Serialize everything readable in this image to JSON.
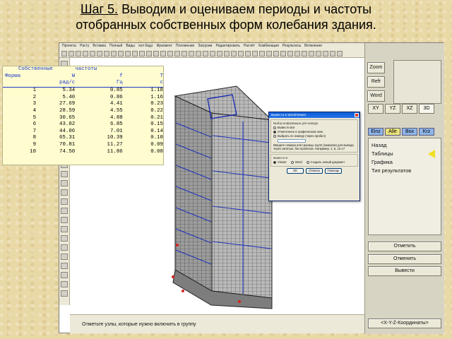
{
  "slide": {
    "step": "Шаг 5.",
    "title_rest": " Выводим и оцениваем периоды и частоты",
    "title_line2": "отобранных собственных форм колебания здания."
  },
  "menu": [
    "Проекты",
    "Расту",
    "Вставка",
    "Полный",
    "Виды",
    "хол бадэ",
    "Фрагмент",
    "Положение",
    "Загрузки",
    "Редактировать",
    "Расчёт",
    "Комбинации",
    "Результаты",
    "Ветвление"
  ],
  "freq_table": {
    "title_left": "Собственные",
    "title_right": "частоты",
    "head1": [
      "Форма",
      "W",
      "f",
      "T"
    ],
    "head2": [
      "",
      "рад/с",
      "Гц",
      "с"
    ],
    "rows": [
      [
        "1",
        "5.34",
        "0.85",
        "1.18"
      ],
      [
        "2",
        "5.40",
        "0.86",
        "1.16"
      ],
      [
        "3",
        "27.69",
        "4.41",
        "0.23"
      ],
      [
        "4",
        "28.59",
        "4.55",
        "0.22"
      ],
      [
        "5",
        "30.65",
        "4.88",
        "0.21"
      ],
      [
        "6",
        "43.02",
        "6.85",
        "0.15"
      ],
      [
        "7",
        "44.06",
        "7.01",
        "0.14"
      ],
      [
        "8",
        "65.31",
        "10.39",
        "0.10"
      ],
      [
        "9",
        "70.81",
        "11.27",
        "0.09"
      ],
      [
        "10",
        "74.50",
        "11.86",
        "0.08"
      ]
    ]
  },
  "dialog": {
    "title": "Вывести в Word/Viewer",
    "group1_legend": "Выбор информации для вывода",
    "opt1": "Вывести всё",
    "opt2": "Отмеченное в графическом окне",
    "opt3": "Выбрать по номеру (через пробел)",
    "hint": "Введите номера или границы групп (номеров) для вывода через запятую, без пробелов. Например, 1, 5, 12-17",
    "group2_legend": "Вывести в",
    "out1": "Viewer",
    "out2": "Word",
    "out3": "Создать новый документ",
    "ok": "OK",
    "cancel": "Отмена",
    "help": "Помощь"
  },
  "right_panel": {
    "zoom": "Zoom",
    "refr": "Refr",
    "word": "Word",
    "views": [
      "XY",
      "YZ",
      "XZ",
      "3D"
    ],
    "modes": [
      {
        "label": "Einz",
        "color": "#8fb4e8"
      },
      {
        "label": "Alle",
        "color": "#e9e07a"
      },
      {
        "label": "Box",
        "color": "#8fb4e8"
      },
      {
        "label": "Krz",
        "color": "#8fb4e8"
      }
    ],
    "list": [
      "Назад",
      "Таблицы",
      "Графика",
      "Тип результатов"
    ],
    "mark": "Отметить",
    "unmark": "Отменить",
    "output": "Вывести",
    "coords": "<X-Y-Z-Координаты>"
  },
  "status": "Отметьте узлы, которые нужно включить в группу"
}
